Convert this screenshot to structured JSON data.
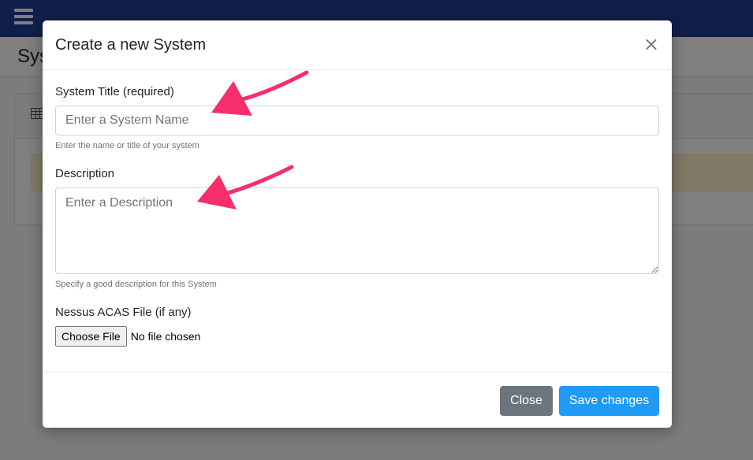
{
  "background": {
    "page_title": "Sys"
  },
  "modal": {
    "title": "Create a new System",
    "close_symbol": "×",
    "system_title": {
      "label": "System Title (required)",
      "placeholder": "Enter a System Name",
      "value": "",
      "help": "Enter the name or title of your system"
    },
    "description": {
      "label": "Description",
      "placeholder": "Enter a Description",
      "value": "",
      "help": "Specify a good description for this System"
    },
    "file": {
      "label": "Nessus ACAS File (if any)",
      "button_label": "Choose File",
      "status": "No file chosen"
    },
    "footer": {
      "close_label": "Close",
      "save_label": "Save changes"
    }
  },
  "colors": {
    "topbar": "#1f3f93",
    "arrow": "#f72d6c",
    "save_button": "#1e9bf6",
    "close_button": "#6c757d"
  },
  "icons": [
    "hamburger-menu-icon",
    "table-icon",
    "close-icon",
    "annotation-arrow"
  ]
}
